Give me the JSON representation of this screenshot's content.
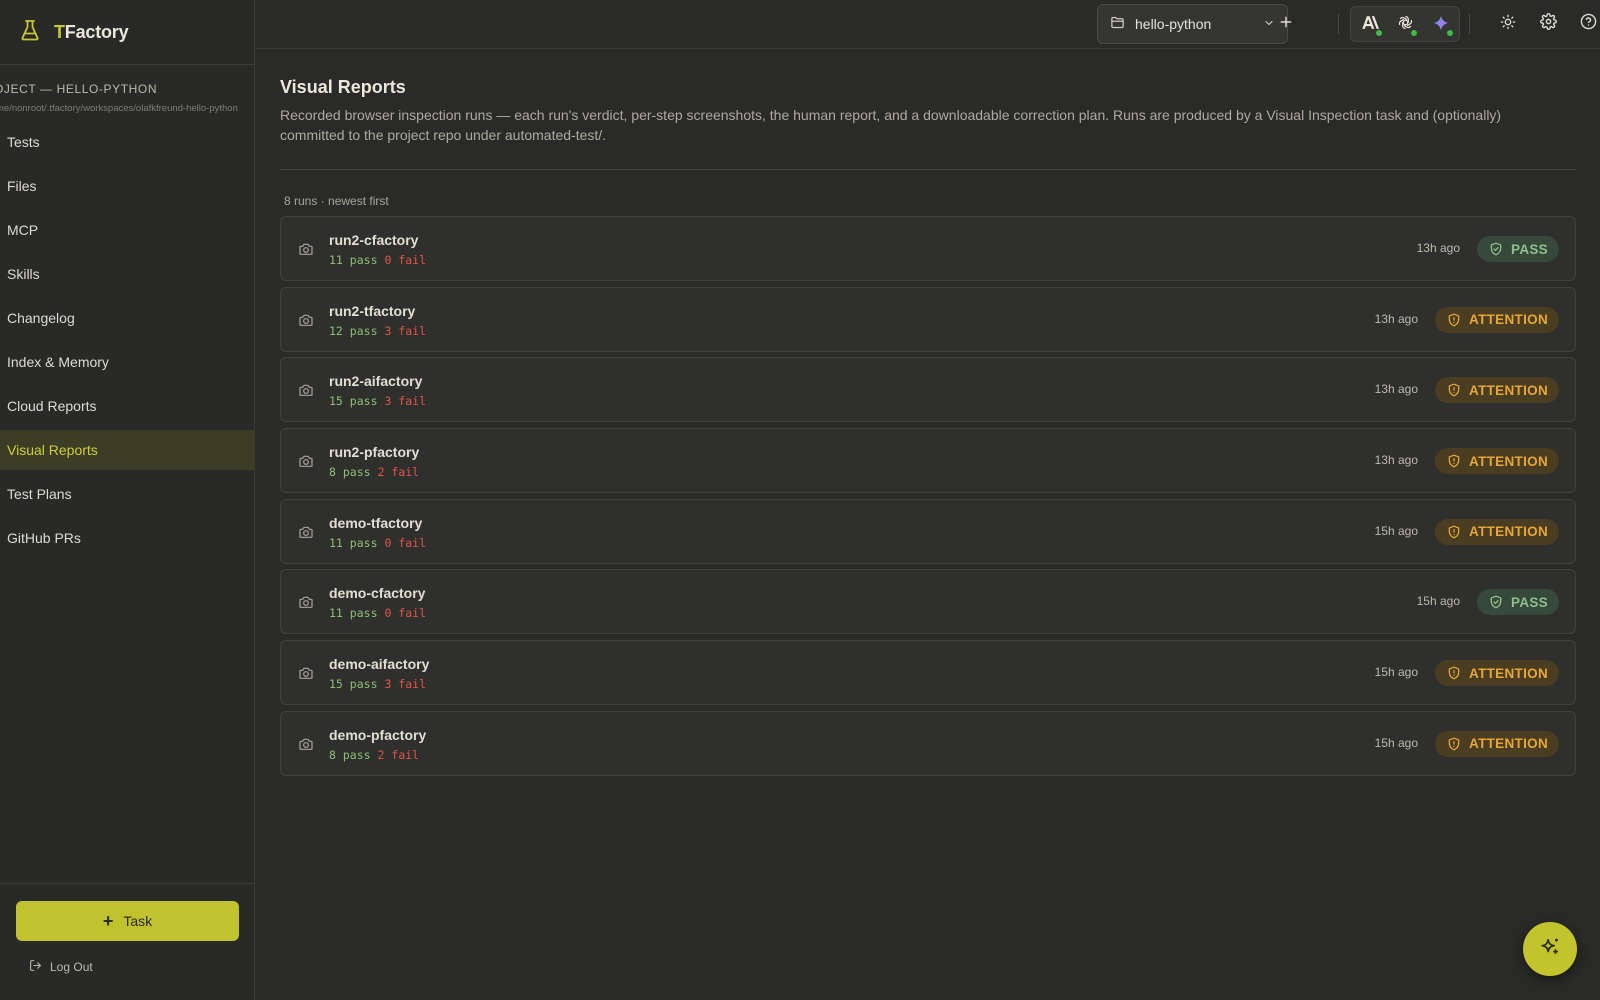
{
  "brand": {
    "first_letter": "T",
    "rest": "Factory"
  },
  "project": {
    "title": "OJECT — HELLO-PYTHON",
    "path": "me/nonroot/.tfactory/workspaces/olafkfreund-hello-python"
  },
  "nav": [
    {
      "label": "Tests",
      "active": false
    },
    {
      "label": "Files",
      "active": false
    },
    {
      "label": "MCP",
      "active": false
    },
    {
      "label": "Skills",
      "active": false
    },
    {
      "label": "Changelog",
      "active": false
    },
    {
      "label": "Index & Memory",
      "active": false
    },
    {
      "label": "Cloud Reports",
      "active": false
    },
    {
      "label": "Visual Reports",
      "active": true
    },
    {
      "label": "Test Plans",
      "active": false
    },
    {
      "label": "GitHub PRs",
      "active": false
    }
  ],
  "sidebar_bottom": {
    "task_label": "Task",
    "logout_label": "Log Out"
  },
  "topbar": {
    "project_name": "hello-python"
  },
  "page": {
    "title": "Visual Reports",
    "description": "Recorded browser inspection runs — each run's verdict, per-step screenshots, the human report, and a downloadable correction plan. Runs are produced by a Visual Inspection task and (optionally) committed to the project repo under automated-test/.",
    "run_count": "8 runs · newest first"
  },
  "runs": [
    {
      "name": "run2-cfactory",
      "pass": "11",
      "fail": "0",
      "time": "13h ago",
      "status": "PASS"
    },
    {
      "name": "run2-tfactory",
      "pass": "12",
      "fail": "3",
      "time": "13h ago",
      "status": "ATTENTION"
    },
    {
      "name": "run2-aifactory",
      "pass": "15",
      "fail": "3",
      "time": "13h ago",
      "status": "ATTENTION"
    },
    {
      "name": "run2-pfactory",
      "pass": "8",
      "fail": "2",
      "time": "13h ago",
      "status": "ATTENTION"
    },
    {
      "name": "demo-tfactory",
      "pass": "11",
      "fail": "0",
      "time": "15h ago",
      "status": "ATTENTION"
    },
    {
      "name": "demo-cfactory",
      "pass": "11",
      "fail": "0",
      "time": "15h ago",
      "status": "PASS"
    },
    {
      "name": "demo-aifactory",
      "pass": "15",
      "fail": "3",
      "time": "15h ago",
      "status": "ATTENTION"
    },
    {
      "name": "demo-pfactory",
      "pass": "8",
      "fail": "2",
      "time": "15h ago",
      "status": "ATTENTION"
    }
  ],
  "labels": {
    "pass_word": "pass",
    "fail_word": "fail"
  },
  "colors": {
    "accent": "#c2c42e",
    "pass": "#8fbf8d",
    "attention": "#e7a636",
    "fail": "#e0554a"
  }
}
